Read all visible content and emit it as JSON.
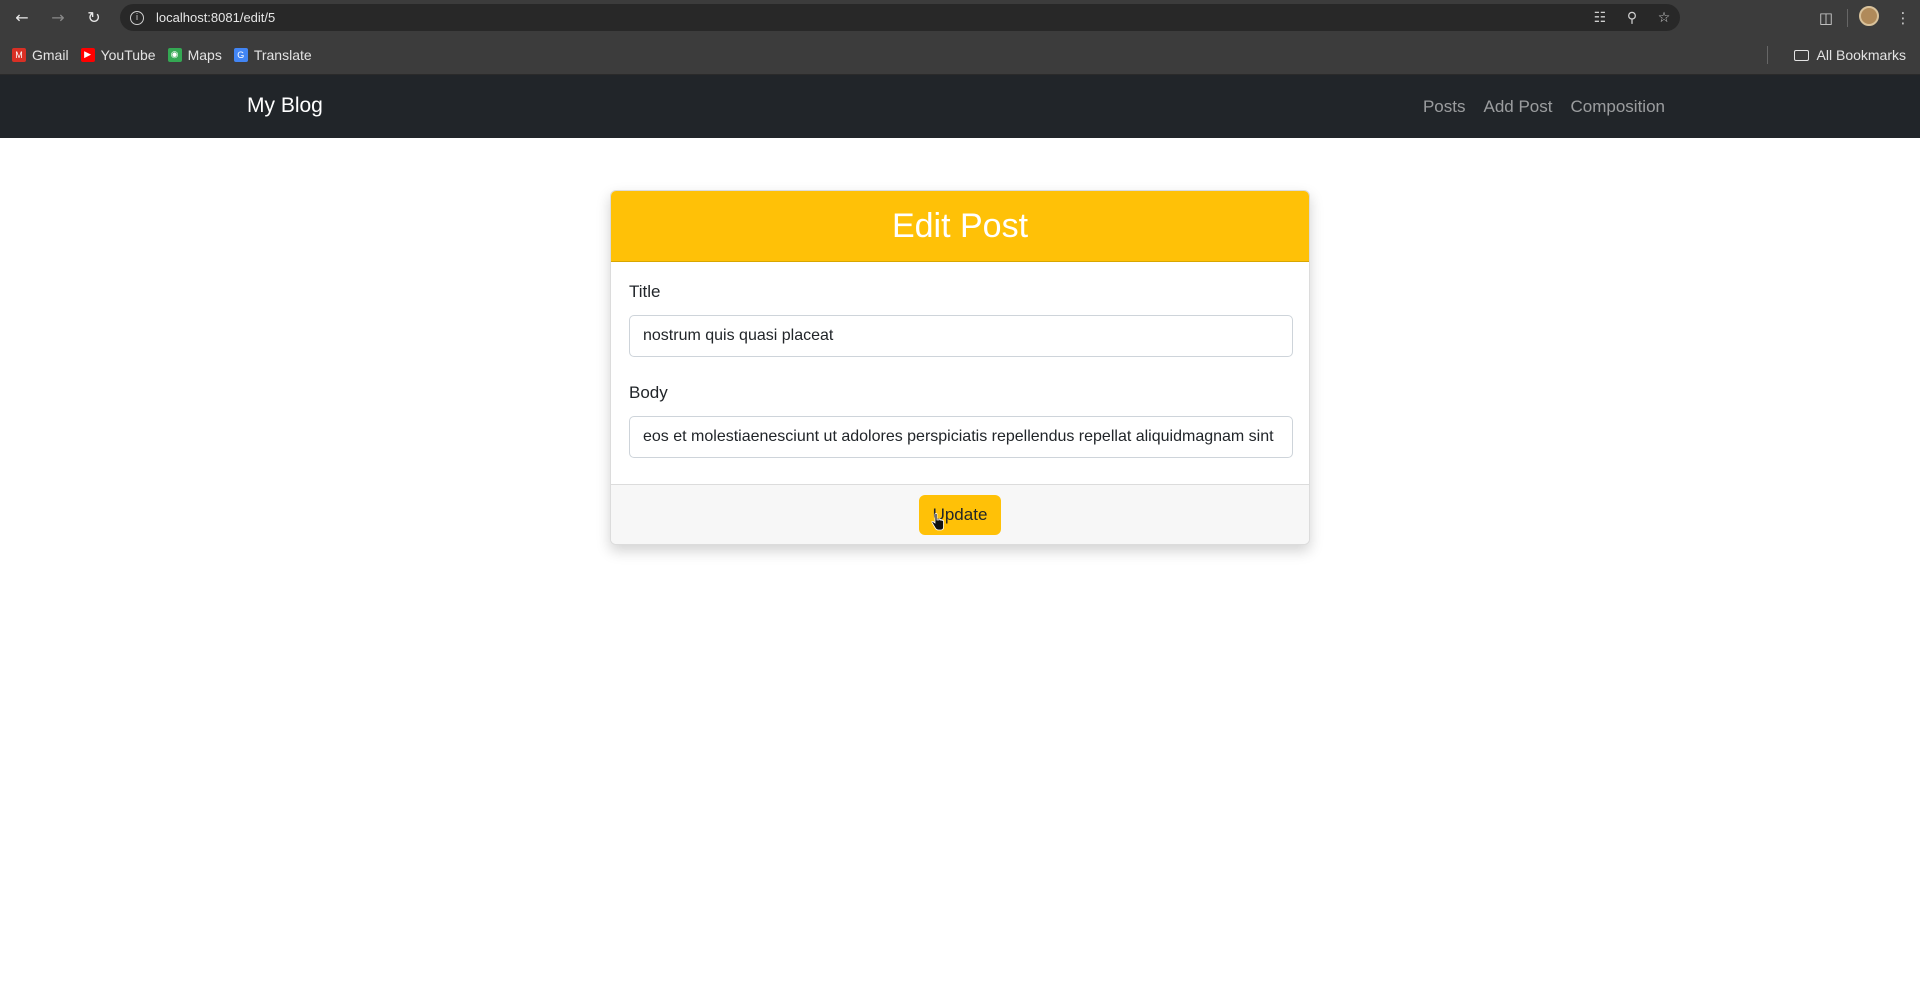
{
  "browser": {
    "url": "localhost:8081/edit/5",
    "bookmarks": [
      {
        "label": "Gmail",
        "color": "#d93025"
      },
      {
        "label": "YouTube",
        "color": "#ff0000"
      },
      {
        "label": "Maps",
        "color": "#34a853"
      },
      {
        "label": "Translate",
        "color": "#4285f4"
      }
    ],
    "all_bookmarks_label": "All Bookmarks"
  },
  "navbar": {
    "brand": "My Blog",
    "links": [
      "Posts",
      "Add Post",
      "Composition"
    ]
  },
  "form": {
    "header": "Edit Post",
    "title_label": "Title",
    "title_value": "nostrum quis quasi placeat",
    "body_label": "Body",
    "body_value": "eos et molestiaenesciunt ut adolores perspiciatis repellendus repellat aliquidmagnam sint rem ipsum est",
    "submit_label": "Update"
  },
  "colors": {
    "accent": "#ffc107",
    "navbar_bg": "#212529"
  }
}
